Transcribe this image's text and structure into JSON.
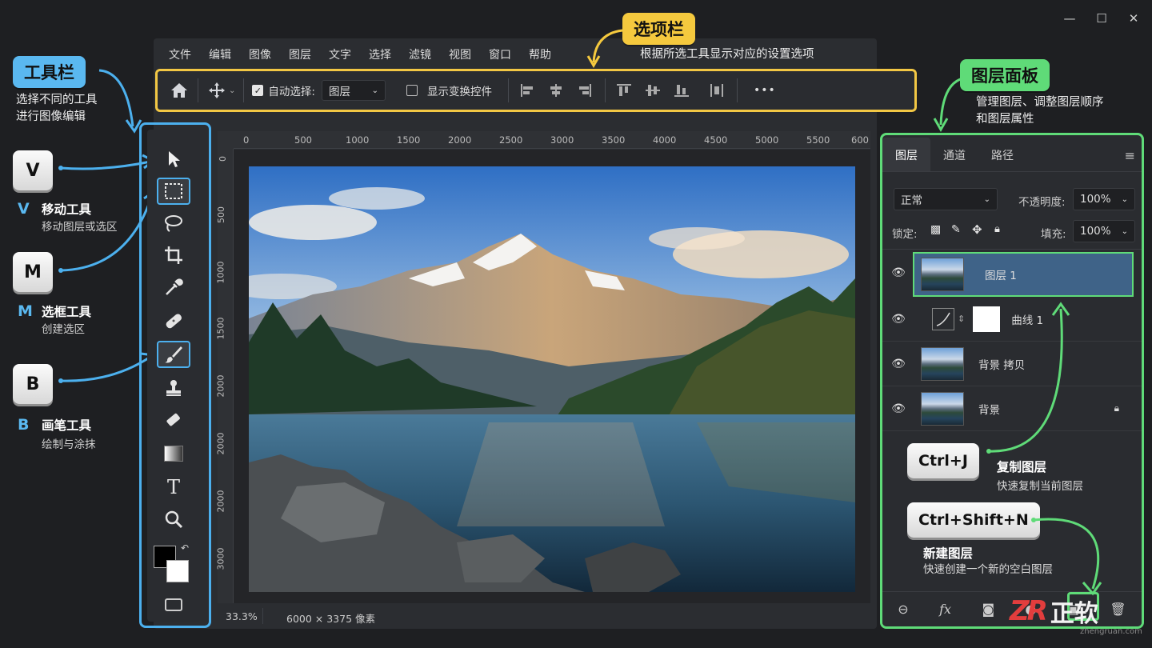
{
  "window_controls": [
    "—",
    "☐",
    "✕"
  ],
  "menu": [
    "文件",
    "编辑",
    "图像",
    "图层",
    "文字",
    "选择",
    "滤镜",
    "视图",
    "窗口",
    "帮助"
  ],
  "options_bar": {
    "auto_select_label": "自动选择:",
    "auto_select_value": "图层",
    "show_transform_label": "显示变换控件",
    "more": "•••"
  },
  "callouts": {
    "toolbar_title": "工具栏",
    "toolbar_desc1": "选择不同的工具",
    "toolbar_desc2": "进行图像编辑",
    "options_title": "选项栏",
    "options_desc": "根据所选工具显示对应的设置选项",
    "layers_title": "图层面板",
    "layers_desc1": "管理图层、调整图层顺序",
    "layers_desc2": "和图层属性"
  },
  "tool_keys": [
    {
      "key": "V",
      "letter": "V",
      "name": "移动工具",
      "sub": "移动图层或选区"
    },
    {
      "key": "M",
      "letter": "M",
      "name": "选框工具",
      "sub": "创建选区"
    },
    {
      "key": "B",
      "letter": "B",
      "name": "画笔工具",
      "sub": "绘制与涂抹"
    }
  ],
  "ruler_top": [
    "0",
    "500",
    "1000",
    "1500",
    "2000",
    "2500",
    "3000",
    "3500",
    "4000",
    "4500",
    "5000",
    "5500",
    "6000"
  ],
  "ruler_left": [
    "0",
    "500",
    "1000",
    "1500",
    "2000",
    "2000",
    "2000",
    "3000"
  ],
  "status": {
    "zoom": "33.3%",
    "size": "6000 × 3375 像素"
  },
  "layers_panel": {
    "tabs": [
      "图层",
      "通道",
      "路径"
    ],
    "blend_mode": "正常",
    "opacity_label": "不透明度:",
    "opacity_value": "100%",
    "lock_label": "锁定:",
    "fill_label": "填充:",
    "fill_value": "100%",
    "layers": [
      {
        "name": "图层 1"
      },
      {
        "name": "曲线 1"
      },
      {
        "name": "背景 拷贝"
      },
      {
        "name": "背景"
      }
    ]
  },
  "shortcuts": [
    {
      "key": "Ctrl+J",
      "title": "复制图层",
      "desc": "快速复制当前图层"
    },
    {
      "key": "Ctrl+Shift+N",
      "title": "新建图层",
      "desc": "快速创建一个新的空白图层"
    }
  ],
  "watermark": {
    "brand": "正软",
    "site": "zhengruan.com"
  }
}
